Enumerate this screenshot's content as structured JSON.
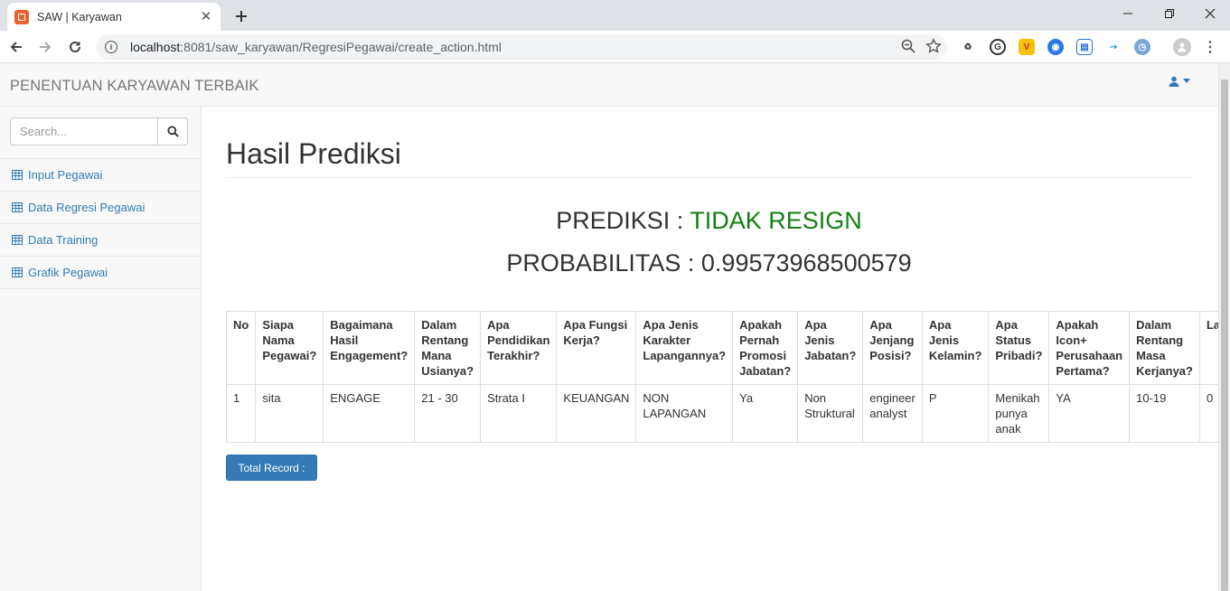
{
  "browser": {
    "tab_title": "SAW | Karyawan",
    "url_host": "localhost",
    "url_rest": ":8081/saw_karyawan/RegresiPegawai/create_action.html"
  },
  "navbar": {
    "brand": "PENENTUAN KARYAWAN TERBAIK"
  },
  "sidebar": {
    "search_placeholder": "Search...",
    "items": [
      {
        "label": "Input Pegawai",
        "icon": "table-icon"
      },
      {
        "label": "Data Regresi Pegawai",
        "icon": "table-icon"
      },
      {
        "label": "Data Training",
        "icon": "table-icon"
      },
      {
        "label": "Grafik Pegawai",
        "icon": "table-icon"
      }
    ]
  },
  "main": {
    "title": "Hasil Prediksi",
    "prediksi_label": "PREDIKSI : ",
    "prediksi_value": "TIDAK RESIGN",
    "probabilitas_label": "PROBABILITAS : ",
    "probabilitas_value": "0.99573968500579",
    "accent_color": "#128012"
  },
  "table": {
    "headers": [
      "No",
      "Siapa Nama Pegawai?",
      "Bagaimana Hasil Engagement?",
      "Dalam Rentang Mana Usianya?",
      "Apa Pendidikan Terakhir?",
      "Apa Fungsi Kerja?",
      "Apa Jenis Karakter Lapangannya?",
      "Apakah Pernah Promosi Jabatan?",
      "Apa Jenis Jabatan?",
      "Apa Jenjang Posisi?",
      "Apa Jenis Kelamin?",
      "Apa Status Pribadi?",
      "Apakah Icon+ Perusahaan Pertama?",
      "Dalam Rentang Masa Kerjanya?",
      "Label"
    ],
    "rows": [
      [
        "1",
        "sita",
        "ENGAGE",
        "21 - 30",
        "Strata I",
        "KEUANGAN",
        "NON LAPANGAN",
        "Ya",
        "Non Struktural",
        "engineer analyst",
        "P",
        "Menikah punya anak",
        "YA",
        "10-19",
        "0"
      ]
    ]
  },
  "total_button": "Total Record :"
}
